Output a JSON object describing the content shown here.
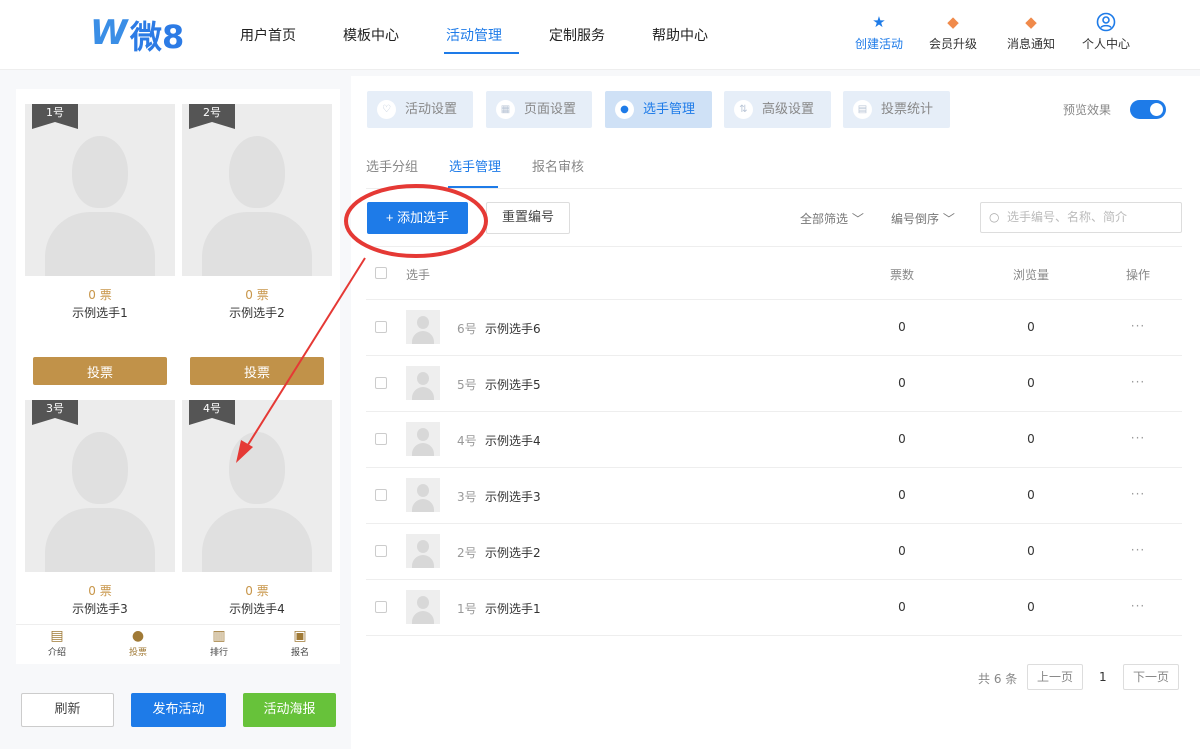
{
  "header": {
    "logo_letter": "W",
    "logo_text": "微8",
    "nav": [
      {
        "label": "用户首页"
      },
      {
        "label": "模板中心"
      },
      {
        "label": "活动管理"
      },
      {
        "label": "定制服务"
      },
      {
        "label": "帮助中心"
      }
    ],
    "actions": [
      {
        "label": "创建活动",
        "icon": "star-icon"
      },
      {
        "label": "会员升级",
        "icon": "member-badge-icon"
      },
      {
        "label": "消息通知",
        "icon": "bell-badge-icon"
      },
      {
        "label": "个人中心",
        "icon": "user-circle-icon"
      }
    ]
  },
  "preview": {
    "cards": [
      {
        "badge": "1号",
        "votes": "0 票",
        "name": "示例选手1",
        "vote_label": "投票"
      },
      {
        "badge": "2号",
        "votes": "0 票",
        "name": "示例选手2",
        "vote_label": "投票"
      },
      {
        "badge": "3号",
        "votes": "0 票",
        "name": "示例选手3"
      },
      {
        "badge": "4号",
        "votes": "0 票",
        "name": "示例选手4"
      }
    ],
    "bottom_nav": [
      {
        "label": "介绍"
      },
      {
        "label": "投票"
      },
      {
        "label": "排行"
      },
      {
        "label": "报名"
      }
    ],
    "buttons": {
      "refresh": "刷新",
      "publish": "发布活动",
      "poster": "活动海报"
    }
  },
  "settings_tabs": [
    {
      "label": "活动设置"
    },
    {
      "label": "页面设置"
    },
    {
      "label": "选手管理"
    },
    {
      "label": "高级设置"
    },
    {
      "label": "投票统计"
    }
  ],
  "preview_toggle": {
    "label": "预览效果",
    "on": true
  },
  "sub_tabs": [
    {
      "label": "选手分组"
    },
    {
      "label": "选手管理"
    },
    {
      "label": "报名审核"
    }
  ],
  "toolbar": {
    "add_label": "+ 添加选手",
    "reset_label": "重置编号",
    "filter_all": "全部筛选",
    "sort": "编号倒序",
    "search_placeholder": "选手编号、名称、简介"
  },
  "table": {
    "columns": [
      "选手",
      "票数",
      "浏览量",
      "操作"
    ],
    "rows": [
      {
        "num": "6号",
        "name": "示例选手6",
        "votes": "0",
        "views": "0",
        "more": "···"
      },
      {
        "num": "5号",
        "name": "示例选手5",
        "votes": "0",
        "views": "0",
        "more": "···"
      },
      {
        "num": "4号",
        "name": "示例选手4",
        "votes": "0",
        "views": "0",
        "more": "···"
      },
      {
        "num": "3号",
        "name": "示例选手3",
        "votes": "0",
        "views": "0",
        "more": "···"
      },
      {
        "num": "2号",
        "name": "示例选手2",
        "votes": "0",
        "views": "0",
        "more": "···"
      },
      {
        "num": "1号",
        "name": "示例选手1",
        "votes": "0",
        "views": "0",
        "more": "···"
      }
    ]
  },
  "pagination": {
    "total": "共 6 条",
    "prev": "上一页",
    "current": "1",
    "next": "下一页"
  },
  "colors": {
    "primary": "#1e7be8",
    "gold": "#c19249",
    "green": "#67c23a",
    "annotation": "#e53935"
  }
}
